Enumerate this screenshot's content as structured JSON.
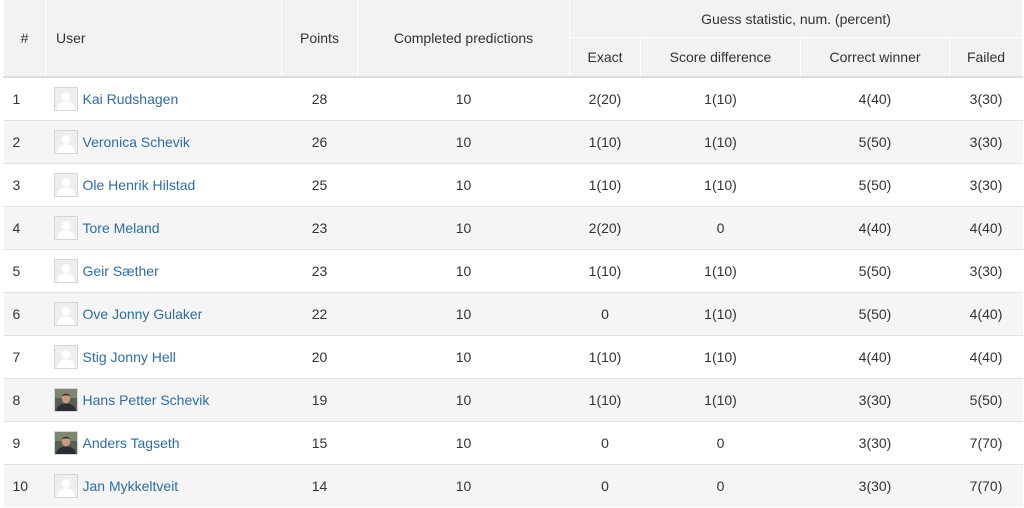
{
  "headers": {
    "rank": "#",
    "user": "User",
    "points": "Points",
    "completed": "Completed predictions",
    "group": "Guess statistic, num. (percent)",
    "exact": "Exact",
    "diff": "Score difference",
    "winner": "Correct winner",
    "failed": "Failed"
  },
  "rows": [
    {
      "rank": "1",
      "name": "Kai Rudshagen",
      "avatar": "placeholder",
      "points": "28",
      "completed": "10",
      "exact": "2(20)",
      "diff": "1(10)",
      "winner": "4(40)",
      "failed": "3(30)"
    },
    {
      "rank": "2",
      "name": "Veronica Schevik",
      "avatar": "placeholder",
      "points": "26",
      "completed": "10",
      "exact": "1(10)",
      "diff": "1(10)",
      "winner": "5(50)",
      "failed": "3(30)"
    },
    {
      "rank": "3",
      "name": "Ole Henrik Hilstad",
      "avatar": "placeholder",
      "points": "25",
      "completed": "10",
      "exact": "1(10)",
      "diff": "1(10)",
      "winner": "5(50)",
      "failed": "3(30)"
    },
    {
      "rank": "4",
      "name": "Tore Meland",
      "avatar": "placeholder",
      "points": "23",
      "completed": "10",
      "exact": "2(20)",
      "diff": "0",
      "winner": "4(40)",
      "failed": "4(40)"
    },
    {
      "rank": "5",
      "name": "Geir Sæther",
      "avatar": "placeholder",
      "points": "23",
      "completed": "10",
      "exact": "1(10)",
      "diff": "1(10)",
      "winner": "5(50)",
      "failed": "3(30)"
    },
    {
      "rank": "6",
      "name": "Ove Jonny Gulaker",
      "avatar": "placeholder",
      "points": "22",
      "completed": "10",
      "exact": "0",
      "diff": "1(10)",
      "winner": "5(50)",
      "failed": "4(40)"
    },
    {
      "rank": "7",
      "name": "Stig Jonny Hell",
      "avatar": "placeholder",
      "points": "20",
      "completed": "10",
      "exact": "1(10)",
      "diff": "1(10)",
      "winner": "4(40)",
      "failed": "4(40)"
    },
    {
      "rank": "8",
      "name": "Hans Petter Schevik",
      "avatar": "photo",
      "points": "19",
      "completed": "10",
      "exact": "1(10)",
      "diff": "1(10)",
      "winner": "3(30)",
      "failed": "5(50)"
    },
    {
      "rank": "9",
      "name": "Anders Tagseth",
      "avatar": "photo",
      "points": "15",
      "completed": "10",
      "exact": "0",
      "diff": "0",
      "winner": "3(30)",
      "failed": "7(70)"
    },
    {
      "rank": "10",
      "name": "Jan Mykkeltveit",
      "avatar": "placeholder",
      "points": "14",
      "completed": "10",
      "exact": "0",
      "diff": "0",
      "winner": "3(30)",
      "failed": "7(70)"
    }
  ],
  "colors": {
    "link": "#2e6da4",
    "header_bg": "#f2f2f2",
    "stripe_bg": "#f5f5f5"
  }
}
